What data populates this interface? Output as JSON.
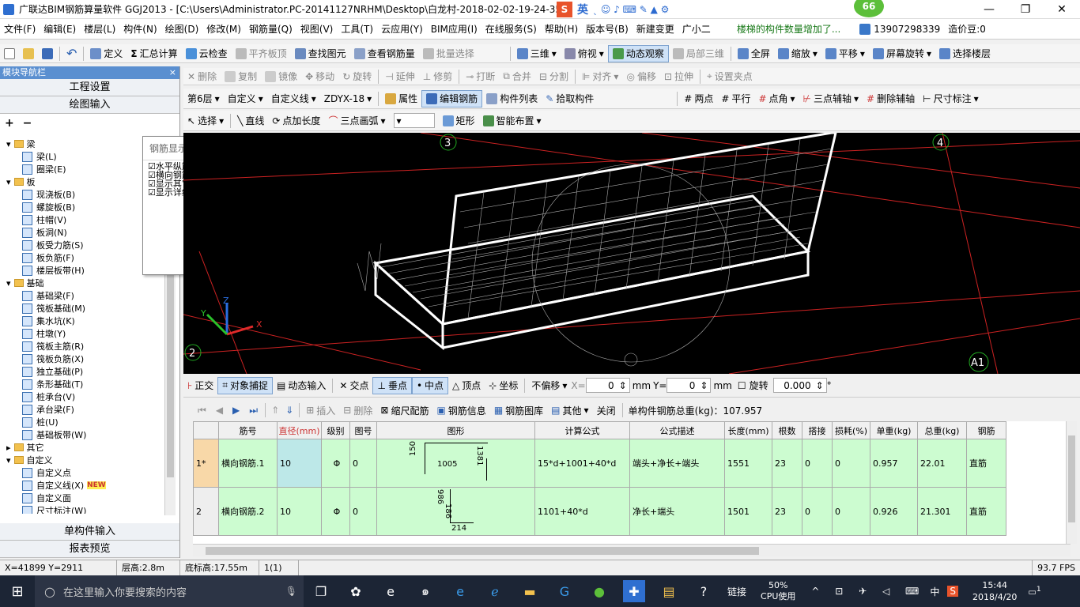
{
  "window": {
    "title": "广联达BIM钢筋算量软件 GGJ2013 - [C:\\Users\\Administrator.PC-20141127NRHM\\Desktop\\白龙村-2018-02-02-19-24-35",
    "badge": "66",
    "ime_label": "英"
  },
  "menu": [
    "文件(F)",
    "编辑(E)",
    "楼层(L)",
    "构件(N)",
    "绘图(D)",
    "修改(M)",
    "钢筋量(Q)",
    "视图(V)",
    "工具(T)",
    "云应用(Y)",
    "BIM应用(I)",
    "在线服务(S)",
    "帮助(H)",
    "版本号(B)",
    "新建变更",
    "广小二"
  ],
  "notice": "楼梯的构件数量增加了...",
  "phone": "13907298339",
  "cost_beans": "造价豆:0",
  "toolbar1": [
    "定义",
    "汇总计算",
    "云检查",
    "平齐板顶",
    "查找图元",
    "查看钢筋量",
    "批量选择",
    "三维",
    "俯视",
    "动态观察",
    "局部三维",
    "全屏",
    "缩放",
    "平移",
    "屏幕旋转",
    "选择楼层"
  ],
  "toolbar2": [
    "删除",
    "复制",
    "镜像",
    "移动",
    "旋转",
    "延伸",
    "修剪",
    "打断",
    "合并",
    "分割",
    "对齐",
    "偏移",
    "拉伸",
    "设置夹点"
  ],
  "toolbar3": {
    "floor": "第6层",
    "c1": "自定义",
    "c2": "自定义线",
    "c3": "ZDYX-18",
    "items": [
      "属性",
      "编辑钢筋",
      "构件列表",
      "拾取构件"
    ],
    "right": [
      "两点",
      "平行",
      "点角",
      "三点辅轴",
      "删除辅轴",
      "尺寸标注"
    ]
  },
  "toolbar4": [
    "选择",
    "直线",
    "点加长度",
    "三点画弧",
    "矩形",
    "智能布置"
  ],
  "nav": {
    "title": "模块导航栏",
    "pin": "ᵖ",
    "close": "×",
    "btn1": "工程设置",
    "btn2": "绘图输入",
    "btn3": "单构件输入",
    "btn4": "报表预览"
  },
  "tree": [
    {
      "level": 0,
      "label": "梁",
      "folder": true
    },
    {
      "level": 1,
      "label": "梁(L)"
    },
    {
      "level": 1,
      "label": "圈梁(E)"
    },
    {
      "level": 0,
      "label": "板",
      "folder": true
    },
    {
      "level": 1,
      "label": "现浇板(B)"
    },
    {
      "level": 1,
      "label": "螺旋板(B)"
    },
    {
      "level": 1,
      "label": "柱帽(V)"
    },
    {
      "level": 1,
      "label": "板洞(N)"
    },
    {
      "level": 1,
      "label": "板受力筋(S)"
    },
    {
      "level": 1,
      "label": "板负筋(F)"
    },
    {
      "level": 1,
      "label": "楼层板带(H)"
    },
    {
      "level": 0,
      "label": "基础",
      "folder": true
    },
    {
      "level": 1,
      "label": "基础梁(F)"
    },
    {
      "level": 1,
      "label": "筏板基础(M)"
    },
    {
      "level": 1,
      "label": "集水坑(K)"
    },
    {
      "level": 1,
      "label": "柱墩(Y)"
    },
    {
      "level": 1,
      "label": "筏板主筋(R)"
    },
    {
      "level": 1,
      "label": "筏板负筋(X)"
    },
    {
      "level": 1,
      "label": "独立基础(P)"
    },
    {
      "level": 1,
      "label": "条形基础(T)"
    },
    {
      "level": 1,
      "label": "桩承台(V)"
    },
    {
      "level": 1,
      "label": "承台梁(F)"
    },
    {
      "level": 1,
      "label": "桩(U)"
    },
    {
      "level": 1,
      "label": "基础板带(W)"
    },
    {
      "level": 0,
      "label": "其它",
      "folder": true,
      "collapsed": true
    },
    {
      "level": 0,
      "label": "自定义",
      "folder": true
    },
    {
      "level": 1,
      "label": "自定义点"
    },
    {
      "level": 1,
      "label": "自定义线(X)",
      "new": "NEW"
    },
    {
      "level": 1,
      "label": "自定义面"
    },
    {
      "level": 1,
      "label": "尺寸标注(W)"
    }
  ],
  "popup": {
    "title": "钢筋显示控制面板",
    "items": [
      "水平纵筋",
      "横向钢筋",
      "显示其它图元",
      "显示详细公式"
    ]
  },
  "view3d": {
    "axes": [
      "3",
      "4",
      "2",
      "A1"
    ],
    "axis_x": "X",
    "axis_y": "Y",
    "axis_z": "Z"
  },
  "editbar": {
    "items": [
      "正交",
      "对象捕捉",
      "动态输入",
      "交点",
      "垂点",
      "中点",
      "顶点",
      "坐标"
    ],
    "offset": "不偏移",
    "x_label": "X=",
    "x_val": "0",
    "y_label": "Y=",
    "y_val": "0",
    "unit": "mm",
    "rotate": "旋转",
    "rot_val": "0.000",
    "deg": "°"
  },
  "rebarbar": {
    "items": [
      "插入",
      "删除",
      "缩尺配筋",
      "钢筋信息",
      "钢筋图库",
      "其他",
      "关闭"
    ],
    "total": "单构件钢筋总重(kg)：107.957"
  },
  "grid": {
    "headers": [
      "筋号",
      "直径(mm)",
      "级别",
      "图号",
      "图形",
      "计算公式",
      "公式描述",
      "长度(mm)",
      "根数",
      "搭接",
      "损耗(%)",
      "单重(kg)",
      "总重(kg)",
      "钢筋"
    ],
    "rows": [
      {
        "idx": "1*",
        "name": "横向钢筋.1",
        "dia": "10",
        "grade": "Φ",
        "fig": "0",
        "shape": [
          "150",
          "1005",
          "1381"
        ],
        "formula": "15*d+1001+40*d",
        "desc": "端头+净长+端头",
        "len": "1551",
        "count": "23",
        "lap": "0",
        "loss": "0",
        "unit_w": "0.957",
        "total_w": "22.01",
        "type": "直筋"
      },
      {
        "idx": "2",
        "name": "横向钢筋.2",
        "dia": "10",
        "grade": "Φ",
        "fig": "0",
        "shape": [
          "986",
          "186",
          "214"
        ],
        "formula": "1101+40*d",
        "desc": "净长+端头",
        "len": "1501",
        "count": "23",
        "lap": "0",
        "loss": "0",
        "unit_w": "0.926",
        "total_w": "21.301",
        "type": "直筋"
      }
    ]
  },
  "status": [
    "X=41899 Y=2911",
    "层高:2.8m",
    "底标高:17.55m",
    "1(1)",
    "93.7 FPS"
  ],
  "taskbar": {
    "search": "在这里输入你要搜索的内容",
    "link": "链接",
    "cpu_pct": "50%",
    "cpu_label": "CPU使用",
    "time": "15:44",
    "date": "2018/4/20",
    "lang": "中",
    "notify": "1"
  },
  "colors": {
    "grid_green": "#ccfcd0",
    "nav_blue": "#5a8fd0",
    "taskbar": "#1c2535"
  }
}
